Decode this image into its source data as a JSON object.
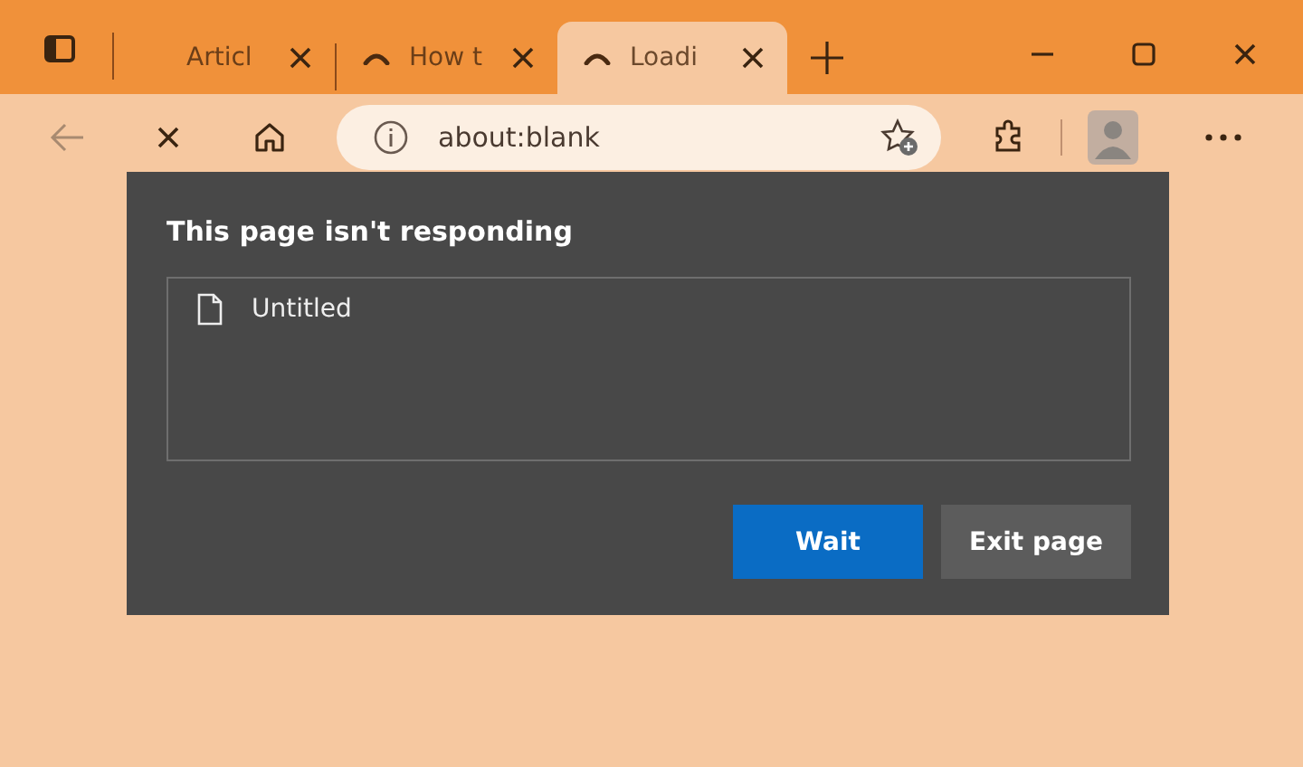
{
  "tabs": [
    {
      "title": "Articl",
      "loading": false,
      "selected": false
    },
    {
      "title": "How t",
      "loading": true,
      "selected": false
    },
    {
      "title": "Loadi",
      "loading": true,
      "selected": true
    }
  ],
  "address_bar": {
    "value": "about:blank"
  },
  "dialog": {
    "title": "This page isn't responding",
    "pages": [
      "Untitled"
    ],
    "buttons": [
      {
        "label": "Wait",
        "kind": "primary"
      },
      {
        "label": "Exit page",
        "kind": "secondary"
      }
    ]
  }
}
